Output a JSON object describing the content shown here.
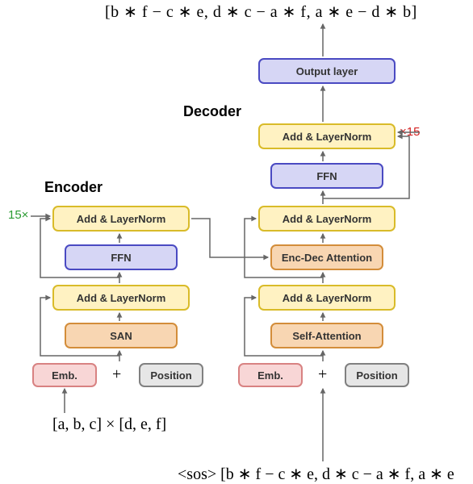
{
  "io": {
    "output_expr": "[b ∗ f − c ∗ e, d ∗ c − a ∗ f, a ∗ e − d ∗ b]",
    "encoder_input": "[a, b, c] × [d, e, f]",
    "decoder_input": "<sos> [b ∗ f − c ∗ e, d ∗ c − a ∗ f, a ∗ e"
  },
  "sections": {
    "encoder": "Encoder",
    "decoder": "Decoder"
  },
  "repeat": {
    "encoder_count": "15×",
    "decoder_count": "×15",
    "encoder_color": "#2a9b32",
    "decoder_color": "#d42020"
  },
  "encoder": {
    "addnorm2": "Add & LayerNorm",
    "ffn": "FFN",
    "addnorm1": "Add & LayerNorm",
    "san": "SAN",
    "emb": "Emb.",
    "plus": "+",
    "pos": "Position"
  },
  "decoder": {
    "output_layer": "Output layer",
    "addnorm3": "Add & LayerNorm",
    "ffn": "FFN",
    "addnorm2": "Add & LayerNorm",
    "encdec": "Enc-Dec Attention",
    "addnorm1": "Add & LayerNorm",
    "selfattn": "Self-Attention",
    "emb": "Emb.",
    "plus": "+",
    "pos": "Position"
  },
  "colors": {
    "yellow": "#fff2c2",
    "purple": "#d6d6f5",
    "orange": "#f8d6b2",
    "pink": "#f8d6d6",
    "gray": "#e6e6e6"
  }
}
